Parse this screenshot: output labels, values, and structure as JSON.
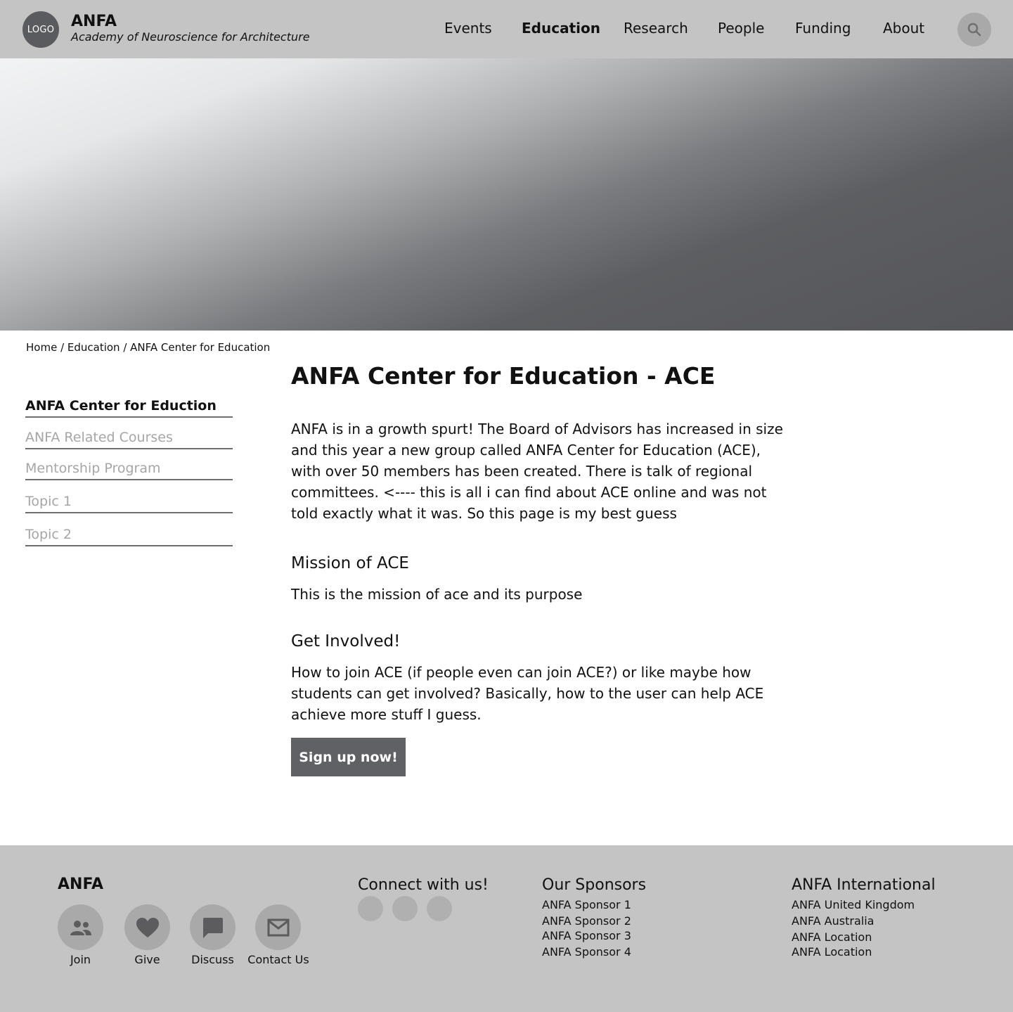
{
  "header": {
    "logo_text": "LOGO",
    "brand_name": "ANFA",
    "brand_subtitle": "Academy of Neuroscience for Architecture",
    "nav": [
      {
        "label": "Events"
      },
      {
        "label": "Education",
        "active": true
      },
      {
        "label": "Research"
      },
      {
        "label": "People"
      },
      {
        "label": "Funding"
      },
      {
        "label": "About"
      }
    ],
    "search_icon": "search-icon"
  },
  "breadcrumb": {
    "text": "Home / Education / ANFA Center for Education"
  },
  "sidebar": {
    "items": [
      {
        "label": "ANFA Center for Eduction",
        "active": true
      },
      {
        "label": "ANFA Related Courses"
      },
      {
        "label": "Mentorship Program"
      },
      {
        "label": "Topic 1"
      },
      {
        "label": "Topic 2"
      }
    ]
  },
  "main": {
    "title": "ANFA Center for Education - ACE",
    "intro": "ANFA is in a growth spurt! The Board of Advisors has increased in size and this year a new group called ANFA Center for Education (ACE), with over 50 members has been created.  There is talk of regional committees.  <---- this is all i can find about ACE online and was not told exactly what it was. So this page is my best guess",
    "mission_heading": "Mission of ACE",
    "mission_text": "This is the mission of ace and its purpose",
    "involved_heading": "Get Involved!",
    "involved_text": "How to join ACE (if people even can join ACE?) or like maybe how students can get involved? Basically, how to the user can help ACE achieve more stuff I guess.",
    "signup_label": "Sign up now!"
  },
  "footer": {
    "anfa_heading": "ANFA",
    "actions": [
      {
        "label": "Join",
        "icon": "people-icon"
      },
      {
        "label": "Give",
        "icon": "heart-icon"
      },
      {
        "label": "Discuss",
        "icon": "chat-icon"
      },
      {
        "label": "Contact Us",
        "icon": "mail-icon"
      }
    ],
    "connect_heading": "Connect with us!",
    "sponsors_heading": "Our Sponsors",
    "sponsors": [
      "ANFA Sponsor 1",
      "ANFA Sponsor 2",
      "ANFA Sponsor 3",
      "ANFA Sponsor 4"
    ],
    "international_heading": "ANFA International",
    "international": [
      "ANFA United Kingdom",
      "ANFA Australia",
      "ANFA Location",
      "ANFA Location"
    ]
  },
  "colors": {
    "header_bg": "#c4c4c4",
    "button_bg": "#606165",
    "logo_bg": "#5a5b5e",
    "sidebar_inactive": "#a6a6a6"
  }
}
